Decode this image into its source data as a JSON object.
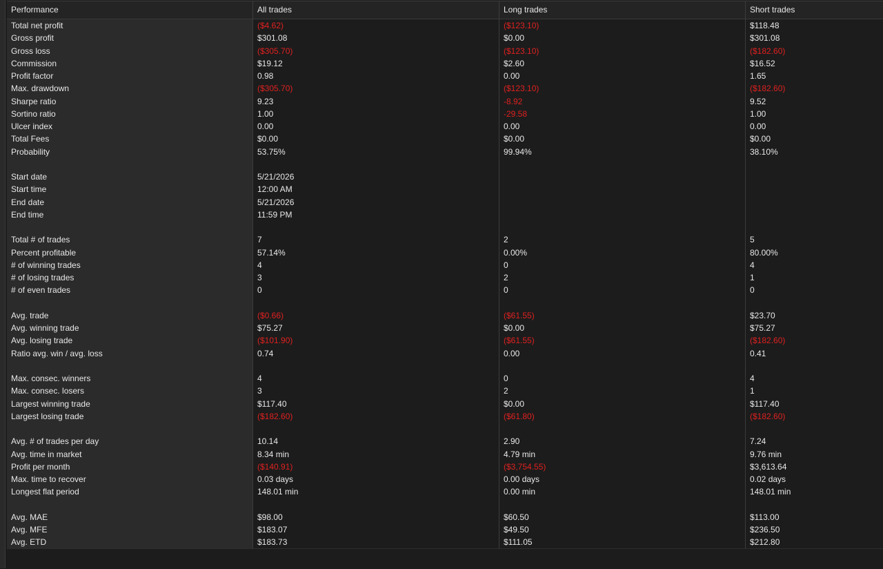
{
  "headers": [
    "Performance",
    "All trades",
    "Long trades",
    "Short trades"
  ],
  "rows": [
    {
      "label": "Total net profit",
      "all": "($4.62)",
      "long": "($123.10)",
      "short": "$118.48",
      "neg": [
        true,
        true,
        false
      ]
    },
    {
      "label": "Gross profit",
      "all": "$301.08",
      "long": "$0.00",
      "short": "$301.08",
      "neg": [
        false,
        false,
        false
      ]
    },
    {
      "label": "Gross loss",
      "all": "($305.70)",
      "long": "($123.10)",
      "short": "($182.60)",
      "neg": [
        true,
        true,
        true
      ]
    },
    {
      "label": "Commission",
      "all": "$19.12",
      "long": "$2.60",
      "short": "$16.52",
      "neg": [
        false,
        false,
        false
      ]
    },
    {
      "label": "Profit factor",
      "all": "0.98",
      "long": "0.00",
      "short": "1.65",
      "neg": [
        false,
        false,
        false
      ]
    },
    {
      "label": "Max. drawdown",
      "all": "($305.70)",
      "long": "($123.10)",
      "short": "($182.60)",
      "neg": [
        true,
        true,
        true
      ]
    },
    {
      "label": "Sharpe ratio",
      "all": "9.23",
      "long": "-8.92",
      "short": "9.52",
      "neg": [
        false,
        true,
        false
      ]
    },
    {
      "label": "Sortino ratio",
      "all": "1.00",
      "long": "-29.58",
      "short": "1.00",
      "neg": [
        false,
        true,
        false
      ]
    },
    {
      "label": "Ulcer index",
      "all": "0.00",
      "long": "0.00",
      "short": "0.00",
      "neg": [
        false,
        false,
        false
      ]
    },
    {
      "label": "Total Fees",
      "all": "$0.00",
      "long": "$0.00",
      "short": "$0.00",
      "neg": [
        false,
        false,
        false
      ]
    },
    {
      "label": "Probability",
      "all": "53.75%",
      "long": "99.94%",
      "short": "38.10%",
      "neg": [
        false,
        false,
        false
      ]
    },
    {
      "spacer": true
    },
    {
      "label": "Start date",
      "all": "5/21/2026",
      "long": "",
      "short": "",
      "neg": [
        false,
        false,
        false
      ]
    },
    {
      "label": "Start time",
      "all": "12:00 AM",
      "long": "",
      "short": "",
      "neg": [
        false,
        false,
        false
      ]
    },
    {
      "label": "End date",
      "all": "5/21/2026",
      "long": "",
      "short": "",
      "neg": [
        false,
        false,
        false
      ]
    },
    {
      "label": "End time",
      "all": "11:59 PM",
      "long": "",
      "short": "",
      "neg": [
        false,
        false,
        false
      ]
    },
    {
      "spacer": true
    },
    {
      "label": "Total # of trades",
      "all": "7",
      "long": "2",
      "short": "5",
      "neg": [
        false,
        false,
        false
      ]
    },
    {
      "label": "Percent profitable",
      "all": "57.14%",
      "long": "0.00%",
      "short": "80.00%",
      "neg": [
        false,
        false,
        false
      ]
    },
    {
      "label": "# of winning trades",
      "all": "4",
      "long": "0",
      "short": "4",
      "neg": [
        false,
        false,
        false
      ]
    },
    {
      "label": "# of losing trades",
      "all": "3",
      "long": "2",
      "short": "1",
      "neg": [
        false,
        false,
        false
      ]
    },
    {
      "label": "# of even trades",
      "all": "0",
      "long": "0",
      "short": "0",
      "neg": [
        false,
        false,
        false
      ]
    },
    {
      "spacer": true
    },
    {
      "label": "Avg. trade",
      "all": "($0.66)",
      "long": "($61.55)",
      "short": "$23.70",
      "neg": [
        true,
        true,
        false
      ]
    },
    {
      "label": "Avg. winning trade",
      "all": "$75.27",
      "long": "$0.00",
      "short": "$75.27",
      "neg": [
        false,
        false,
        false
      ]
    },
    {
      "label": "Avg. losing trade",
      "all": "($101.90)",
      "long": "($61.55)",
      "short": "($182.60)",
      "neg": [
        true,
        true,
        true
      ]
    },
    {
      "label": "Ratio avg. win / avg. loss",
      "all": "0.74",
      "long": "0.00",
      "short": "0.41",
      "neg": [
        false,
        false,
        false
      ]
    },
    {
      "spacer": true
    },
    {
      "label": "Max. consec. winners",
      "all": "4",
      "long": "0",
      "short": "4",
      "neg": [
        false,
        false,
        false
      ]
    },
    {
      "label": "Max. consec. losers",
      "all": "3",
      "long": "2",
      "short": "1",
      "neg": [
        false,
        false,
        false
      ]
    },
    {
      "label": "Largest winning trade",
      "all": "$117.40",
      "long": "$0.00",
      "short": "$117.40",
      "neg": [
        false,
        false,
        false
      ]
    },
    {
      "label": "Largest losing trade",
      "all": "($182.60)",
      "long": "($61.80)",
      "short": "($182.60)",
      "neg": [
        true,
        true,
        true
      ]
    },
    {
      "spacer": true
    },
    {
      "label": "Avg. # of trades per day",
      "all": "10.14",
      "long": "2.90",
      "short": "7.24",
      "neg": [
        false,
        false,
        false
      ]
    },
    {
      "label": "Avg. time in market",
      "all": "8.34 min",
      "long": "4.79 min",
      "short": "9.76 min",
      "neg": [
        false,
        false,
        false
      ]
    },
    {
      "label": "Profit per month",
      "all": "($140.91)",
      "long": "($3,754.55)",
      "short": "$3,613.64",
      "neg": [
        true,
        true,
        false
      ]
    },
    {
      "label": "Max. time to recover",
      "all": "0.03 days",
      "long": "0.00 days",
      "short": "0.02 days",
      "neg": [
        false,
        false,
        false
      ]
    },
    {
      "label": "Longest flat period",
      "all": "148.01 min",
      "long": "0.00 min",
      "short": "148.01 min",
      "neg": [
        false,
        false,
        false
      ]
    },
    {
      "spacer": true
    },
    {
      "label": "Avg. MAE",
      "all": "$98.00",
      "long": "$60.50",
      "short": "$113.00",
      "neg": [
        false,
        false,
        false
      ]
    },
    {
      "label": "Avg. MFE",
      "all": "$183.07",
      "long": "$49.50",
      "short": "$236.50",
      "neg": [
        false,
        false,
        false
      ]
    },
    {
      "label": "Avg. ETD",
      "all": "$183.73",
      "long": "$111.05",
      "short": "$212.80",
      "neg": [
        false,
        false,
        false
      ]
    }
  ],
  "colors": {
    "background": "#1c1c1c",
    "label_column": "#2b2b2b",
    "text": "#e8e8e8",
    "negative": "#e02020"
  }
}
